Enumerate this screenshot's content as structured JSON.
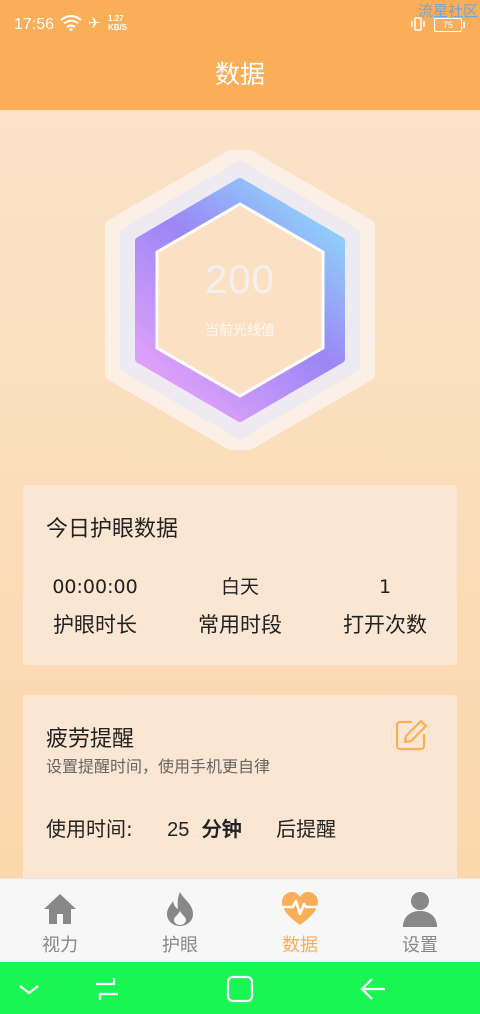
{
  "status_bar": {
    "time": "17:56",
    "net_speed_value": "1.27",
    "net_speed_unit": "KB/S",
    "battery": "75",
    "watermark": "流星社区",
    "icons": [
      "wifi-icon",
      "airplane-icon",
      "vibrate-icon",
      "battery-icon"
    ]
  },
  "header": {
    "title": "数据"
  },
  "gauge": {
    "value": "200",
    "label": "当前光线值",
    "colors": {
      "gradient_top": "#8fd0fa",
      "gradient_mid": "#9b86f5",
      "gradient_bottom": "#e2a2fb"
    }
  },
  "today_card": {
    "title": "今日护眼数据",
    "stats": [
      {
        "value": "00:00:00",
        "label": "护眼时长"
      },
      {
        "value": "白天",
        "label": "常用时段"
      },
      {
        "value": "1",
        "label": "打开次数"
      }
    ]
  },
  "fatigue_card": {
    "title": "疲劳提醒",
    "subtitle": "设置提醒时间，使用手机更自律",
    "usage_label": "使用时间:",
    "usage_value": "25",
    "usage_unit": "分钟",
    "usage_suffix": "后提醒",
    "edit_icon": "edit-icon"
  },
  "bottom_nav": {
    "items": [
      {
        "label": "视力",
        "icon": "home-icon",
        "active": false
      },
      {
        "label": "护眼",
        "icon": "flame-icon",
        "active": false
      },
      {
        "label": "数据",
        "icon": "heart-pulse-icon",
        "active": true
      },
      {
        "label": "设置",
        "icon": "user-icon",
        "active": false
      }
    ]
  },
  "colors": {
    "accent": "#fbae58",
    "system_nav": "#19f654",
    "card_bg": "#fae6d3"
  }
}
